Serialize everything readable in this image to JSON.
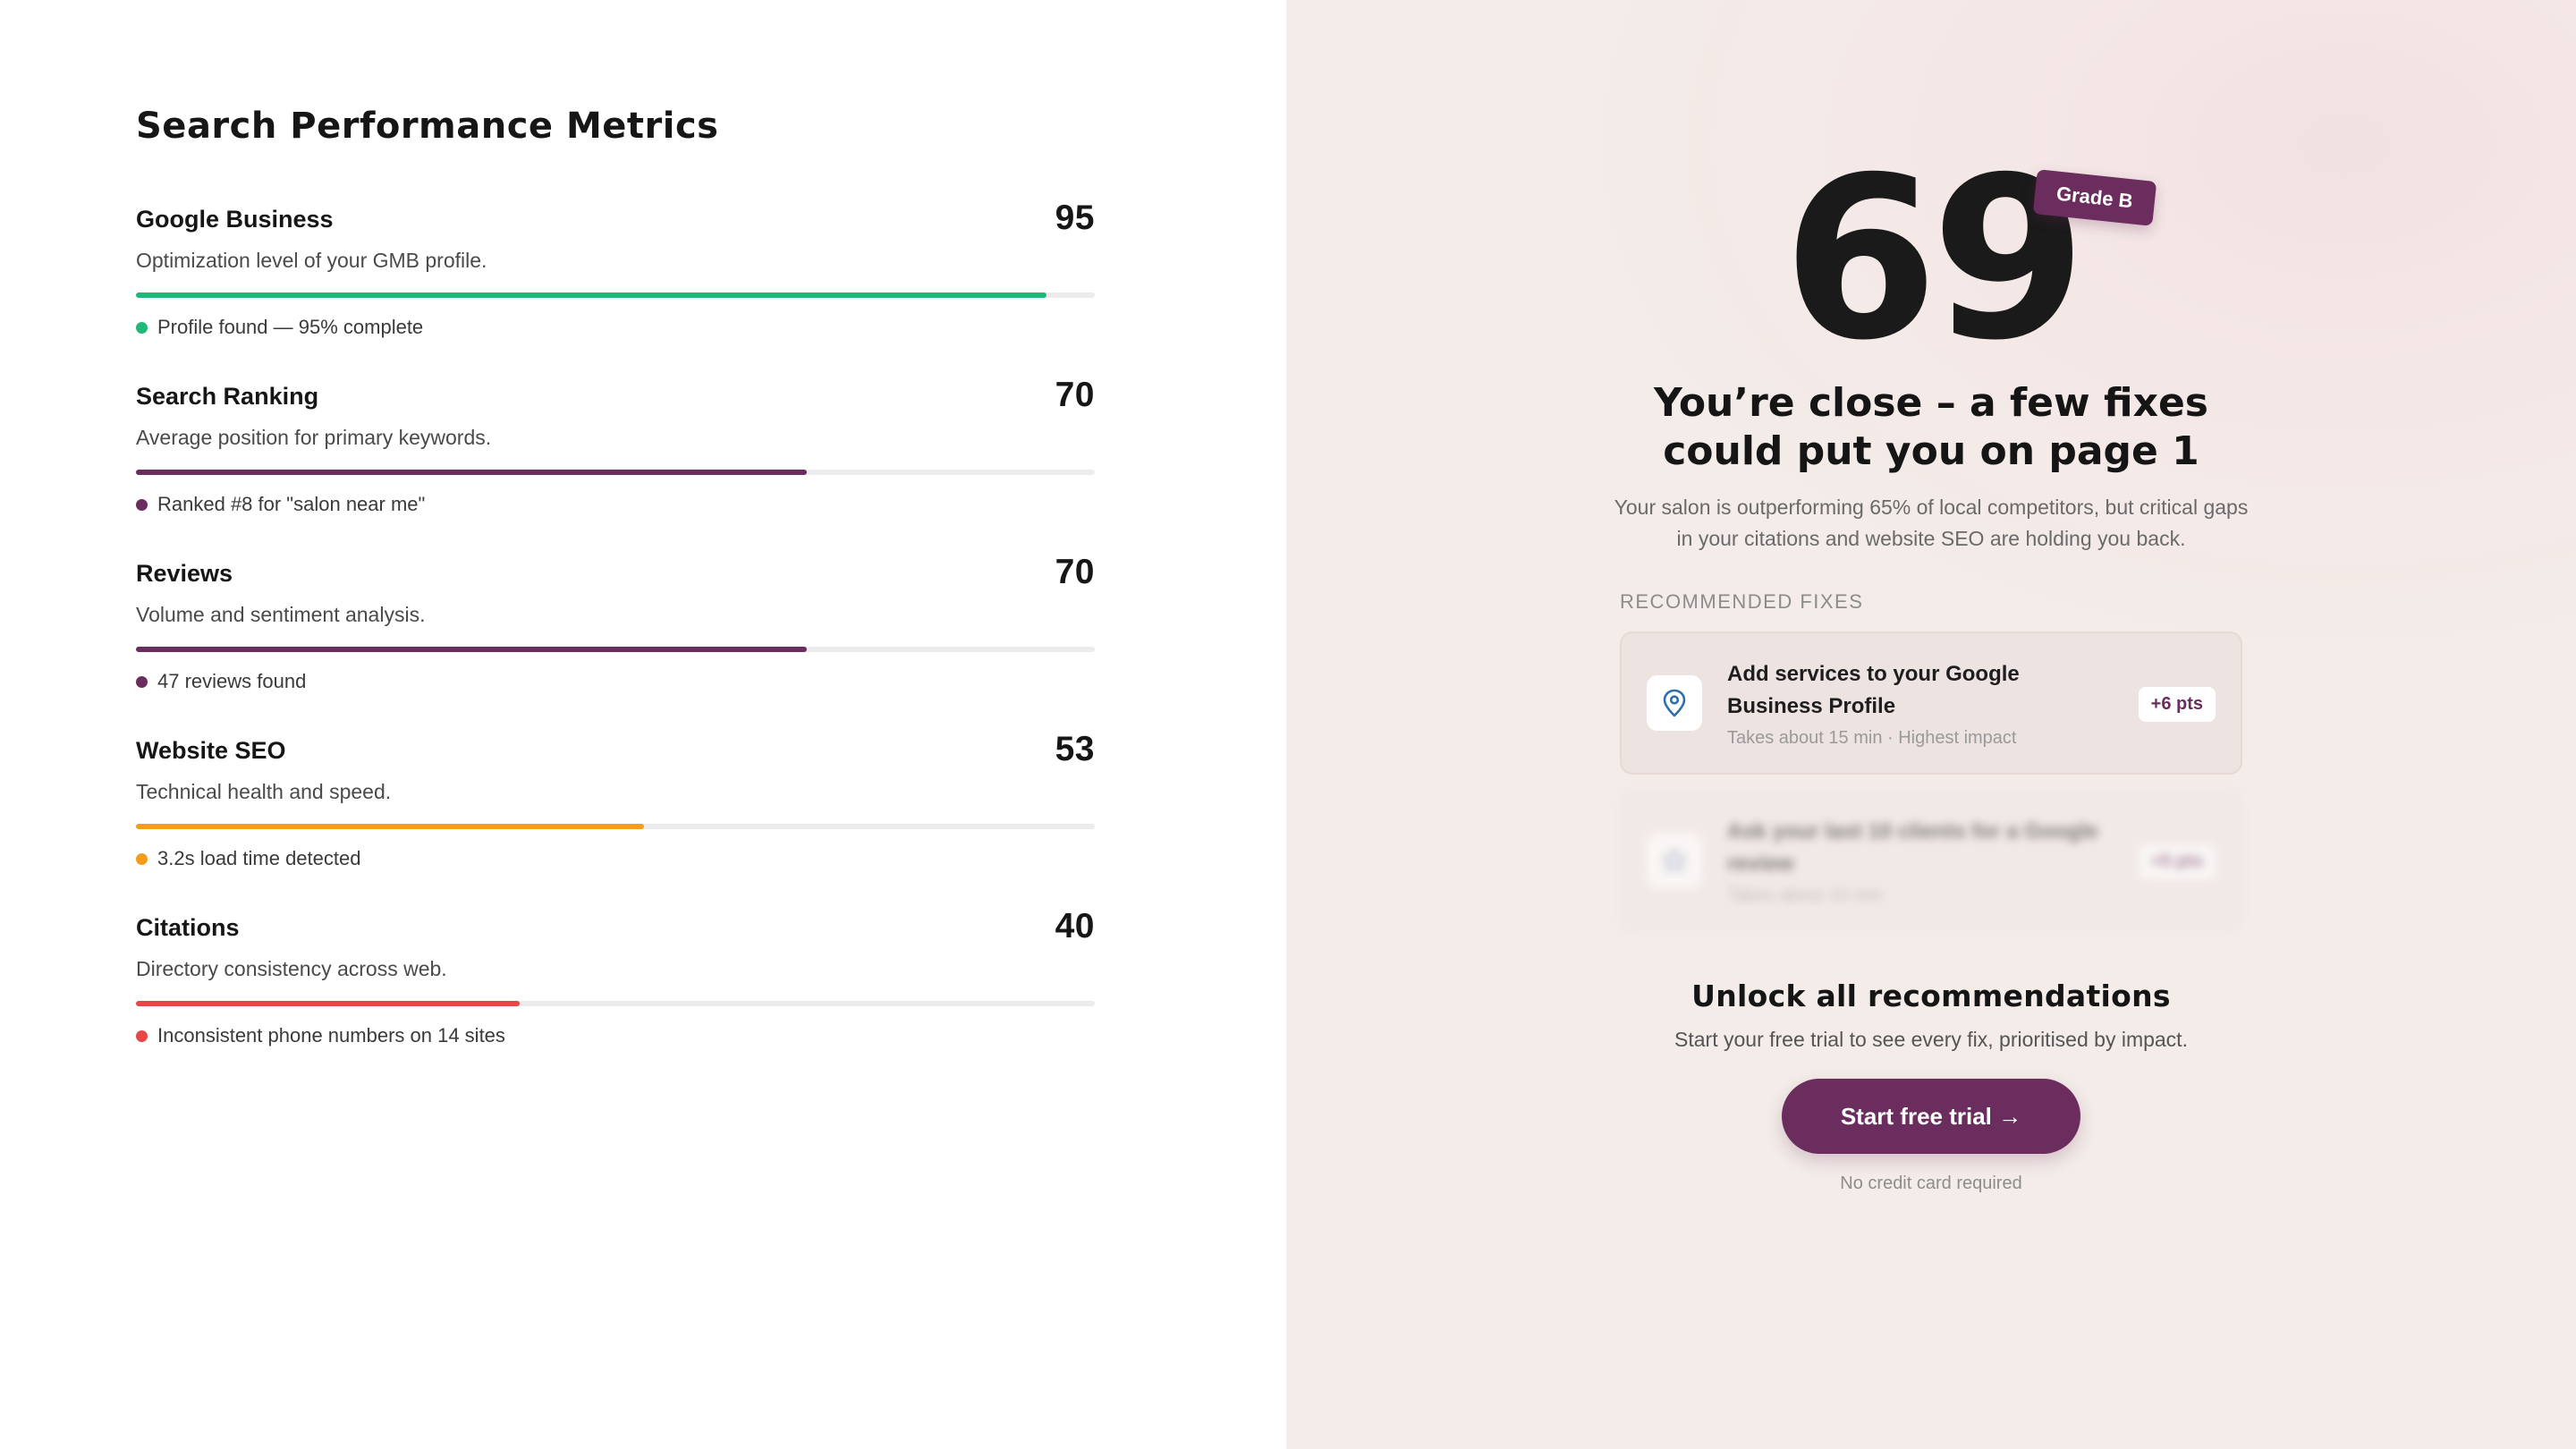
{
  "left": {
    "title": "Search Performance Metrics",
    "metrics": [
      {
        "name": "Google Business",
        "score": "95",
        "description": "Optimization level of your GMB profile.",
        "note": "Profile found — 95% complete",
        "progress": 0.95,
        "color": "#1fb87a"
      },
      {
        "name": "Search Ranking",
        "score": "70",
        "description": "Average position for primary keywords.",
        "note": "Ranked #8 for \"salon near me\"",
        "progress": 0.7,
        "color": "#6b2d5e"
      },
      {
        "name": "Reviews",
        "score": "70",
        "description": "Volume and sentiment analysis.",
        "note": "47 reviews found",
        "progress": 0.7,
        "color": "#6b2d5e"
      },
      {
        "name": "Website SEO",
        "score": "53",
        "description": "Technical health and speed.",
        "note": "3.2s load time detected",
        "progress": 0.53,
        "color": "#f59d1a"
      },
      {
        "name": "Citations",
        "score": "40",
        "description": "Directory consistency across web.",
        "note": "Inconsistent phone numbers on 14 sites",
        "progress": 0.4,
        "color": "#e84545"
      }
    ]
  },
  "right": {
    "overall_score": "69",
    "grade": "Grade B",
    "headline": "You’re close – a few fixes could put you on page 1",
    "subtext": "Your salon is outperforming 65% of local competitors, but critical gaps in your citations and website SEO are holding you back.",
    "recommended_label": "RECOMMENDED FIXES",
    "fixes": [
      {
        "icon": "map-pin-icon",
        "title": "Add services to your Google Business Profile",
        "meta": "Takes about 15 min · Highest impact",
        "points": "+6 pts"
      },
      {
        "icon": "star-icon",
        "title": "Ask your last 10 clients for a Google review",
        "meta": "Takes about 10 min",
        "points": "+5 pts"
      }
    ],
    "unlock_title": "Unlock all recommendations",
    "unlock_sub": "Start your free trial to see every fix, prioritised by impact.",
    "cta_label": "Start free trial →",
    "cta_footnote": "No credit card required",
    "accent_color": "#6b2d5e"
  }
}
